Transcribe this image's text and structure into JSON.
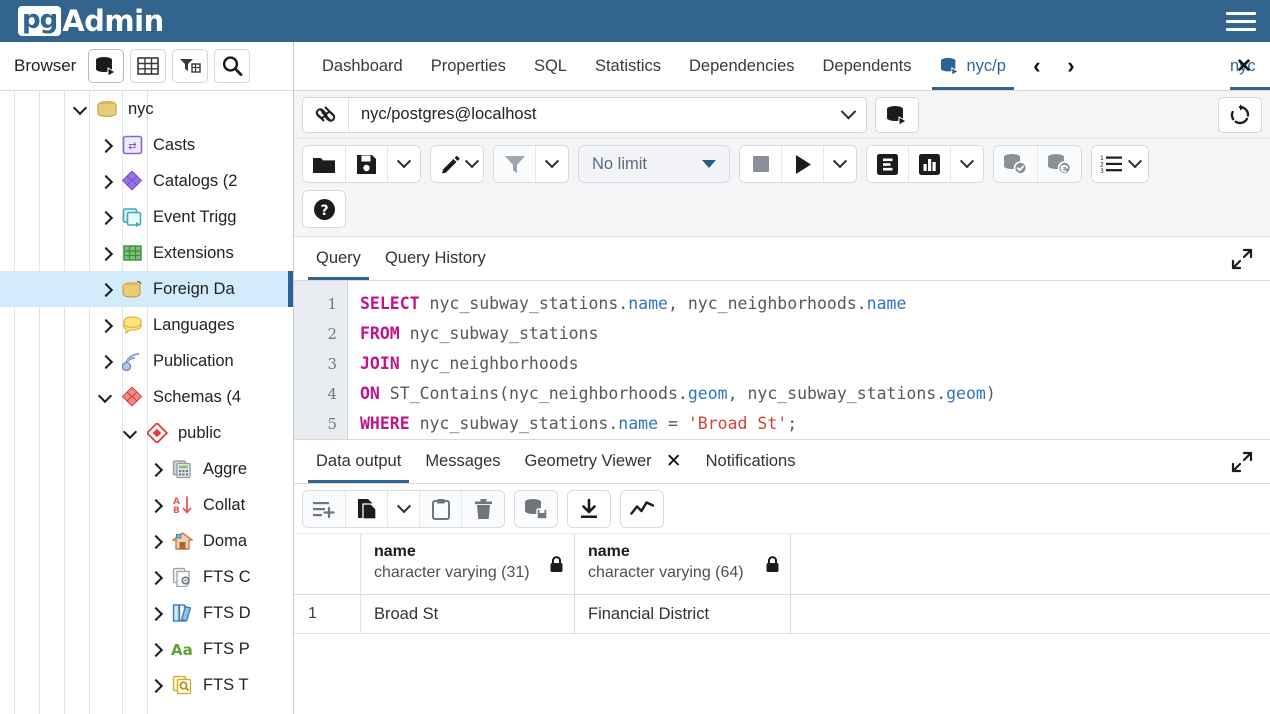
{
  "brand": {
    "pg": "pg",
    "admin": "Admin",
    "menu_icon": "hamburger-menu-icon"
  },
  "sidebar": {
    "title": "Browser",
    "tools": [
      {
        "name": "object-explorer-icon",
        "label": "Object Explorer"
      },
      {
        "name": "grid-icon",
        "label": "Grid"
      },
      {
        "name": "filter-icon",
        "label": "Filter"
      },
      {
        "name": "search-icon",
        "label": "Search"
      }
    ],
    "tree": [
      {
        "label": "nyc",
        "depth": 3,
        "open": true,
        "icon": "database-icon",
        "selected": false
      },
      {
        "label": "Casts",
        "depth": 4,
        "open": false,
        "icon": "casts-icon",
        "selected": false
      },
      {
        "label": "Catalogs (2",
        "depth": 4,
        "open": false,
        "icon": "catalogs-icon",
        "selected": false
      },
      {
        "label": "Event Trigg",
        "depth": 4,
        "open": false,
        "icon": "event-trigger-icon",
        "selected": false
      },
      {
        "label": "Extensions",
        "depth": 4,
        "open": false,
        "icon": "extensions-icon",
        "selected": false
      },
      {
        "label": "Foreign Da",
        "depth": 4,
        "open": false,
        "icon": "foreign-data-icon",
        "selected": true
      },
      {
        "label": "Languages",
        "depth": 4,
        "open": false,
        "icon": "languages-icon",
        "selected": false
      },
      {
        "label": "Publication",
        "depth": 4,
        "open": false,
        "icon": "publications-icon",
        "selected": false
      },
      {
        "label": "Schemas (4",
        "depth": 4,
        "open": true,
        "icon": "schemas-icon",
        "selected": false
      },
      {
        "label": "public",
        "depth": 5,
        "open": true,
        "icon": "schema-icon",
        "selected": false
      },
      {
        "label": "Aggre",
        "depth": 6,
        "open": false,
        "icon": "aggregates-icon",
        "selected": false
      },
      {
        "label": "Collat",
        "depth": 6,
        "open": false,
        "icon": "collations-icon",
        "selected": false
      },
      {
        "label": "Doma",
        "depth": 6,
        "open": false,
        "icon": "domains-icon",
        "selected": false
      },
      {
        "label": "FTS C",
        "depth": 6,
        "open": false,
        "icon": "fts-configurations-icon",
        "selected": false
      },
      {
        "label": "FTS D",
        "depth": 6,
        "open": false,
        "icon": "fts-dictionaries-icon",
        "selected": false
      },
      {
        "label": "FTS P",
        "depth": 6,
        "open": false,
        "icon": "fts-parsers-icon",
        "selected": false
      },
      {
        "label": "FTS T",
        "depth": 6,
        "open": false,
        "icon": "fts-templates-icon",
        "selected": false
      }
    ]
  },
  "object_tabs": {
    "items": [
      {
        "label": "Dashboard",
        "active": false
      },
      {
        "label": "Properties",
        "active": false
      },
      {
        "label": "SQL",
        "active": false
      },
      {
        "label": "Statistics",
        "active": false
      },
      {
        "label": "Dependencies",
        "active": false
      },
      {
        "label": "Dependents",
        "active": false
      }
    ],
    "query_tab": {
      "label": "nyc/p",
      "active": true,
      "icon": "query-tool-icon"
    },
    "prev_label": "‹",
    "next_label": "›",
    "clipped_tab": {
      "label": "nyc",
      "close_icon": "close-icon"
    }
  },
  "connection": {
    "icon": "connection-icon",
    "value": "nyc/postgres@localhost",
    "dropdown_icon": "chevron-down-icon",
    "manage_icon": "manage-connections-icon",
    "refresh_icon": "reset-icon"
  },
  "query_toolbar": {
    "open_file": "open-file-icon",
    "save_file": "save-file-icon",
    "save_dropdown": "chevron-down-icon",
    "edit": "edit-pencil-icon",
    "edit_dropdown": "chevron-down-icon",
    "filter": "filter-icon",
    "filter_dropdown": "chevron-down-icon",
    "limit_label": "No limit",
    "limit_dropdown": "triangle-down-icon",
    "stop": "stop-icon",
    "execute": "play-icon",
    "execute_dropdown": "chevron-down-icon",
    "explain": "explain-icon",
    "explain_analyze": "explain-analyze-icon",
    "explain_dropdown": "chevron-down-icon",
    "commit": "commit-icon",
    "rollback": "rollback-icon",
    "macros": "macros-icon",
    "macros_dropdown": "chevron-down-icon",
    "help": "help-icon"
  },
  "query_panel": {
    "tabs": [
      {
        "label": "Query",
        "active": true
      },
      {
        "label": "Query History",
        "active": false
      }
    ],
    "expand_icon": "expand-icon",
    "line_numbers": [
      "1",
      "2",
      "3",
      "4",
      "5"
    ],
    "lines": [
      [
        {
          "t": "SELECT",
          "c": "kw"
        },
        {
          "t": " nyc_subway_stations.",
          "c": ""
        },
        {
          "t": "name",
          "c": "col"
        },
        {
          "t": ", nyc_neighborhoods.",
          "c": ""
        },
        {
          "t": "name",
          "c": "col"
        }
      ],
      [
        {
          "t": "FROM",
          "c": "kw"
        },
        {
          "t": " nyc_subway_stations",
          "c": ""
        }
      ],
      [
        {
          "t": "JOIN",
          "c": "kw"
        },
        {
          "t": " nyc_neighborhoods",
          "c": ""
        }
      ],
      [
        {
          "t": "ON",
          "c": "kw"
        },
        {
          "t": " ST_Contains(nyc_neighborhoods.",
          "c": ""
        },
        {
          "t": "geom",
          "c": "col"
        },
        {
          "t": ", nyc_subway_stations.",
          "c": ""
        },
        {
          "t": "geom",
          "c": "col"
        },
        {
          "t": ")",
          "c": ""
        }
      ],
      [
        {
          "t": "WHERE",
          "c": "kw"
        },
        {
          "t": " nyc_subway_stations.",
          "c": ""
        },
        {
          "t": "name",
          "c": "col"
        },
        {
          "t": " = ",
          "c": ""
        },
        {
          "t": "'Broad St'",
          "c": "str"
        },
        {
          "t": ";",
          "c": ""
        }
      ]
    ]
  },
  "output_panel": {
    "tabs": [
      {
        "label": "Data output",
        "active": true,
        "closable": false
      },
      {
        "label": "Messages",
        "active": false,
        "closable": false
      },
      {
        "label": "Geometry Viewer",
        "active": false,
        "closable": true
      },
      {
        "label": "Notifications",
        "active": false,
        "closable": false
      }
    ],
    "close_icon": "close-icon",
    "expand_icon": "expand-icon",
    "toolbar": {
      "add_row": "add-row-icon",
      "copy": "copy-icon",
      "copy_dropdown": "chevron-down-icon",
      "paste": "paste-icon",
      "delete": "delete-row-icon",
      "save_data": "save-data-changes-icon",
      "download": "download-csv-icon",
      "graph": "graph-visualiser-icon"
    },
    "grid": {
      "columns": [
        {
          "name": "name",
          "type": "character varying (31)",
          "lock_icon": "lock-icon"
        },
        {
          "name": "name",
          "type": "character varying (64)",
          "lock_icon": "lock-icon"
        }
      ],
      "rows": [
        {
          "num": "1",
          "cells": [
            "Broad St",
            "Financial District"
          ]
        }
      ]
    }
  },
  "colors": {
    "brand_blue": "#32648e",
    "accent": "#326690",
    "selection": "#d2ecfb",
    "keyword": "#c2138a",
    "column": "#2f74c0",
    "string": "#d0463c"
  }
}
